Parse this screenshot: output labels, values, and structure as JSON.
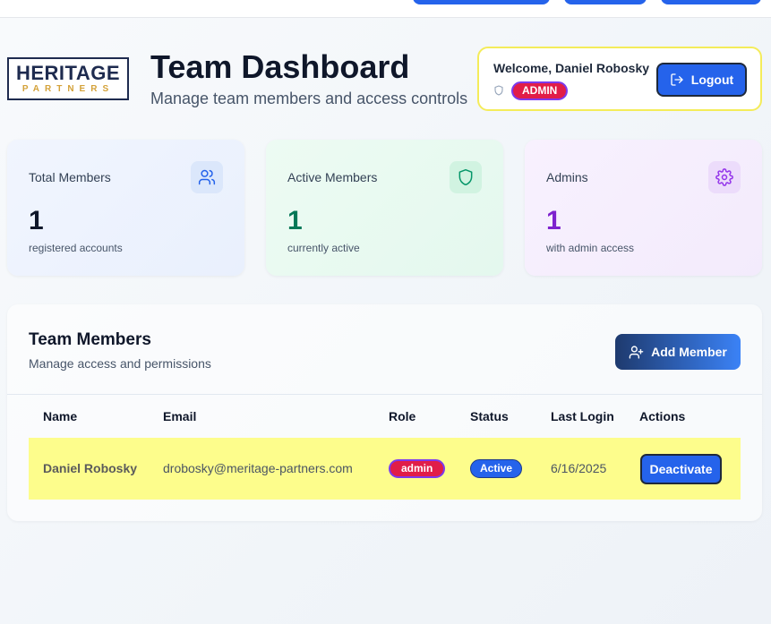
{
  "header": {
    "logo_top": "HERITAGE",
    "logo_bottom": "PARTNERS",
    "title": "Team Dashboard",
    "subtitle": "Manage team members and access controls",
    "welcome_text": "Welcome, Daniel Robosky",
    "role_badge": "ADMIN",
    "logout_label": "Logout"
  },
  "stats": [
    {
      "label": "Total Members",
      "value": "1",
      "sub": "registered accounts",
      "icon": "users-icon",
      "color": "#0f172a"
    },
    {
      "label": "Active Members",
      "value": "1",
      "sub": "currently active",
      "icon": "shield-icon",
      "color": "#047857"
    },
    {
      "label": "Admins",
      "value": "1",
      "sub": "with admin access",
      "icon": "gear-icon",
      "color": "#7e22ce"
    }
  ],
  "team": {
    "title": "Team Members",
    "subtitle": "Manage access and permissions",
    "add_label": "Add Member",
    "columns": [
      "Name",
      "Email",
      "Role",
      "Status",
      "Last Login",
      "Actions"
    ],
    "rows": [
      {
        "name": "Daniel Robosky",
        "email": "drobosky@meritage-partners.com",
        "role": "admin",
        "status": "Active",
        "last_login": "6/16/2025",
        "action": "Deactivate"
      }
    ]
  },
  "colors": {
    "primary": "#2563eb",
    "admin_badge": "#e11d48",
    "highlight": "#fdfd8c",
    "logo_navy": "#1e2b4f",
    "logo_gold": "#d4a23a"
  }
}
